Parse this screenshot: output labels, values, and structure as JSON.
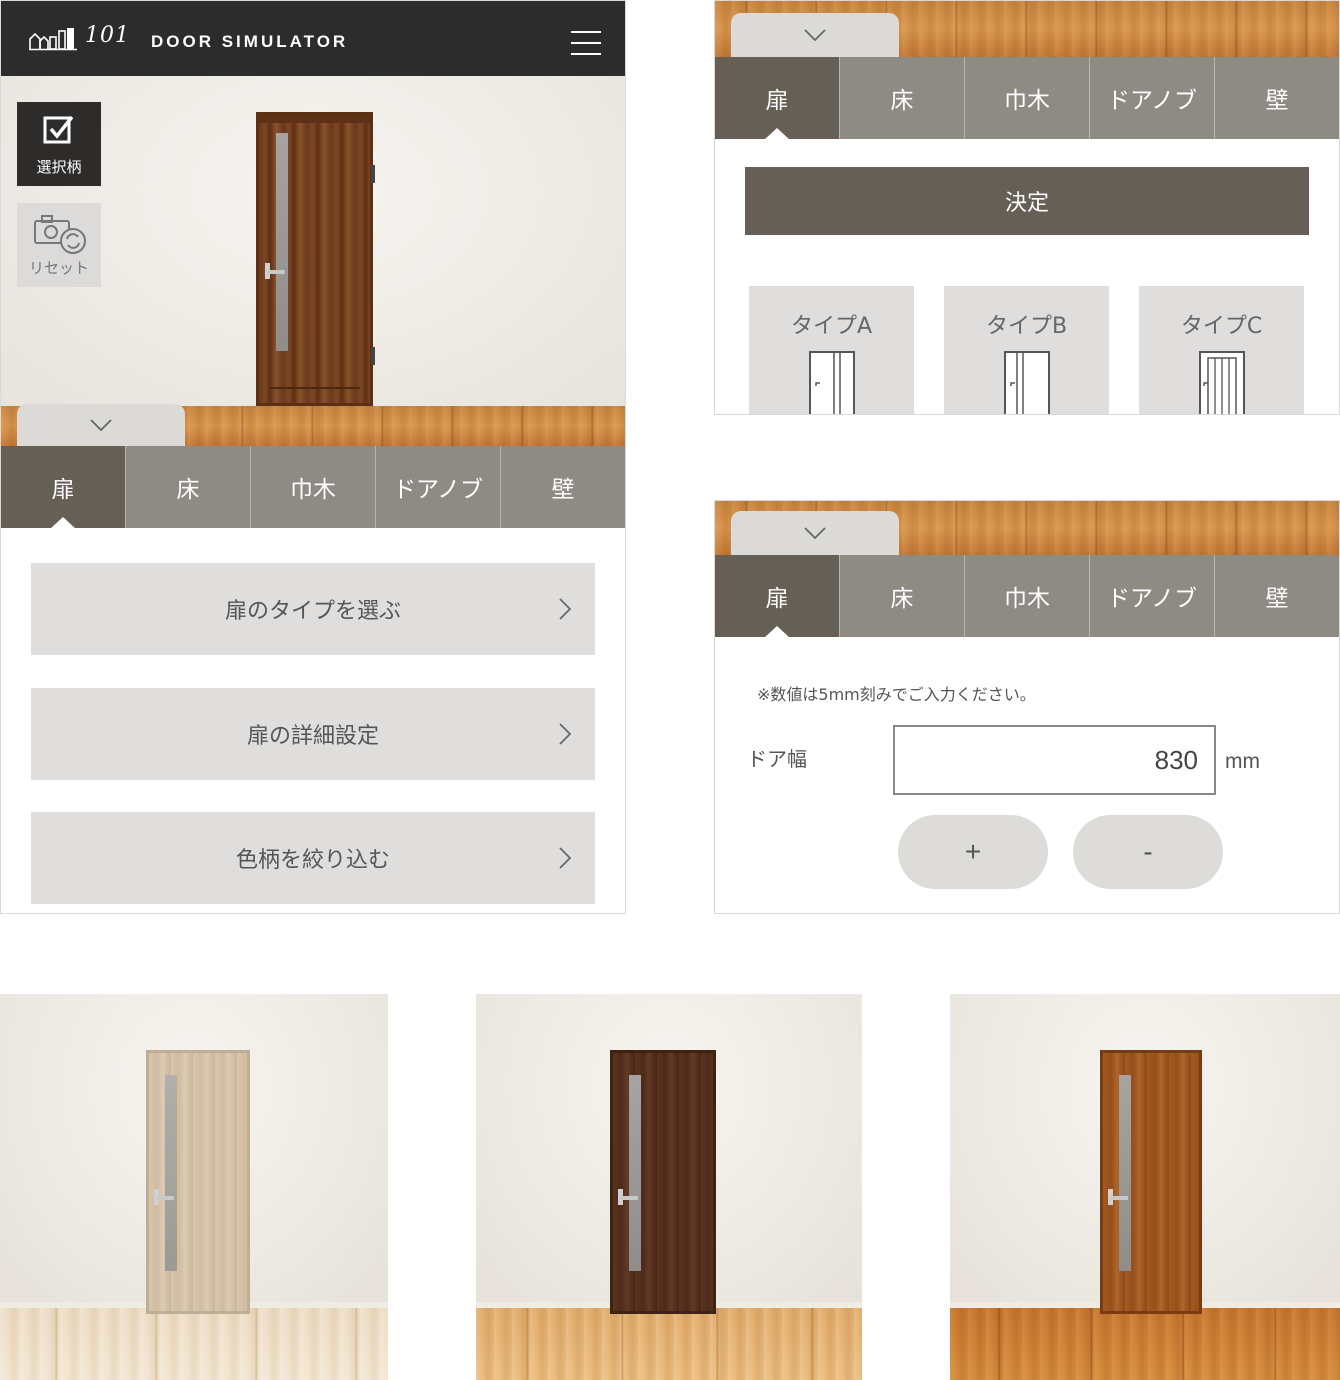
{
  "header": {
    "logo_number": "101",
    "title": "DOOR SIMULATOR"
  },
  "side_buttons": {
    "selected": "選択柄",
    "reset": "リセット"
  },
  "tabs": [
    "扉",
    "床",
    "巾木",
    "ドアノブ",
    "壁"
  ],
  "main_menu": [
    "扉のタイプを選ぶ",
    "扉の詳細設定",
    "色柄を絞り込む"
  ],
  "type_panel": {
    "decide": "決定",
    "types": [
      "タイプA",
      "タイプB",
      "タイプC"
    ]
  },
  "size_panel": {
    "note": "※数値は5mm刻みでご入力ください。",
    "width_label": "ドア幅",
    "width_value": "830",
    "unit": "mm",
    "plus": "+",
    "minus": "-"
  },
  "colors": {
    "header_bg": "#2c2c2c",
    "tab_active": "#665f56",
    "tab_inactive": "#8e8a84",
    "menu_button": "#dfdedc"
  }
}
